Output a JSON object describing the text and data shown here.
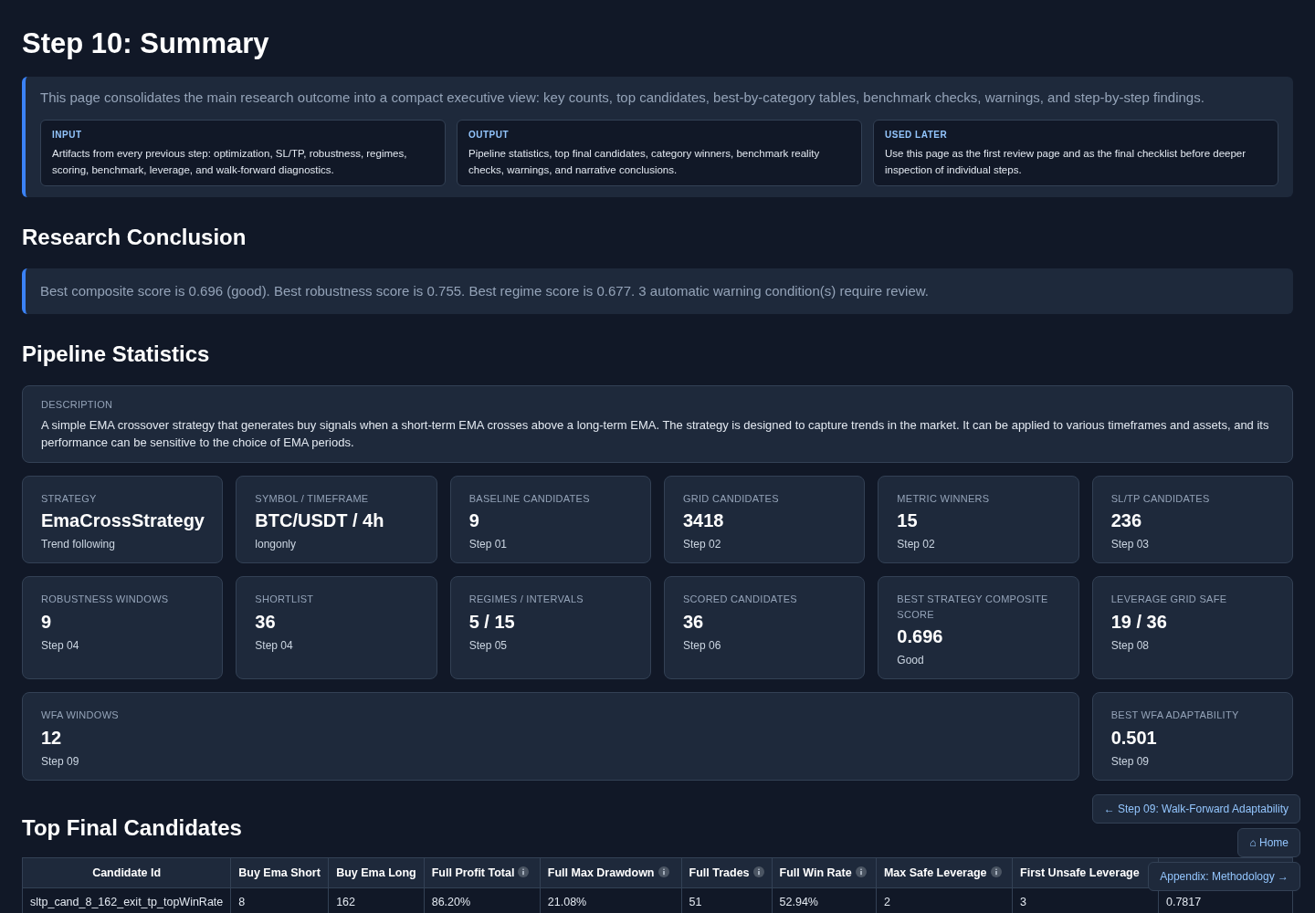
{
  "title": "Step 10: Summary",
  "intro": {
    "text": "This page consolidates the main research outcome into a compact executive view: key counts, top candidates, best-by-category tables, benchmark checks, warnings, and step-by-step findings.",
    "boxes": [
      {
        "label": "INPUT",
        "text": "Artifacts from every previous step: optimization, SL/TP, robustness, regimes, scoring, benchmark, leverage, and walk-forward diagnostics."
      },
      {
        "label": "OUTPUT",
        "text": "Pipeline statistics, top final candidates, category winners, benchmark reality checks, warnings, and narrative conclusions."
      },
      {
        "label": "USED LATER",
        "text": "Use this page as the first review page and as the final checklist before deeper inspection of individual steps."
      }
    ]
  },
  "conclusion": {
    "heading": "Research Conclusion",
    "text": "Best composite score is 0.696 (good). Best robustness score is 0.755. Best regime score is 0.677. 3 automatic warning condition(s) require review."
  },
  "pipeline": {
    "heading": "Pipeline Statistics",
    "description": {
      "label": "DESCRIPTION",
      "text": "A simple EMA crossover strategy that generates buy signals when a short-term EMA crosses above a long-term EMA. The strategy is designed to capture trends in the market. It can be applied to various timeframes and assets, and its performance can be sensitive to the choice of EMA periods."
    },
    "cards": [
      {
        "label": "STRATEGY",
        "value": "EmaCrossStrategy",
        "note": "Trend following"
      },
      {
        "label": "SYMBOL / TIMEFRAME",
        "value": "BTC/USDT / 4h",
        "note": "longonly"
      },
      {
        "label": "BASELINE CANDIDATES",
        "value": "9",
        "note": "Step 01"
      },
      {
        "label": "GRID CANDIDATES",
        "value": "3418",
        "note": "Step 02"
      },
      {
        "label": "METRIC WINNERS",
        "value": "15",
        "note": "Step 02"
      },
      {
        "label": "SL/TP CANDIDATES",
        "value": "236",
        "note": "Step 03"
      },
      {
        "label": "ROBUSTNESS WINDOWS",
        "value": "9",
        "note": "Step 04"
      },
      {
        "label": "SHORTLIST",
        "value": "36",
        "note": "Step 04"
      },
      {
        "label": "REGIMES / INTERVALS",
        "value": "5 / 15",
        "note": "Step 05"
      },
      {
        "label": "SCORED CANDIDATES",
        "value": "36",
        "note": "Step 06"
      },
      {
        "label": "BEST STRATEGY COMPOSITE SCORE",
        "value": "0.696",
        "note": "Good"
      },
      {
        "label": "LEVERAGE GRID SAFE",
        "value": "19 / 36",
        "note": "Step 08"
      },
      {
        "label": "WFA WINDOWS",
        "value": "12",
        "note": "Step 09",
        "wide": true
      },
      {
        "label": "BEST WFA ADAPTABILITY",
        "value": "0.501",
        "note": "Step 09",
        "wide": false
      }
    ]
  },
  "candidates": {
    "heading": "Top Final Candidates",
    "columns": [
      {
        "label": "Candidate Id",
        "info": false
      },
      {
        "label": "Buy Ema Short",
        "info": false
      },
      {
        "label": "Buy Ema Long",
        "info": false
      },
      {
        "label": "Full Profit Total",
        "info": true
      },
      {
        "label": "Full Max Drawdown",
        "info": true
      },
      {
        "label": "Full Trades",
        "info": true
      },
      {
        "label": "Full Win Rate",
        "info": true
      },
      {
        "label": "Max Safe Leverage",
        "info": true
      },
      {
        "label": "First Unsafe Leverage",
        "info": false
      }
    ],
    "rows": [
      [
        "sltp_cand_8_162_exit_tp_topWinRate",
        "8",
        "162",
        "86.20%",
        "21.08%",
        "51",
        "52.94%",
        "2",
        "3",
        "0.7817"
      ]
    ]
  },
  "nav": [
    "← Step 09: Walk-Forward Adaptability",
    "⌂ Home",
    "Appendix: Methodology →"
  ]
}
